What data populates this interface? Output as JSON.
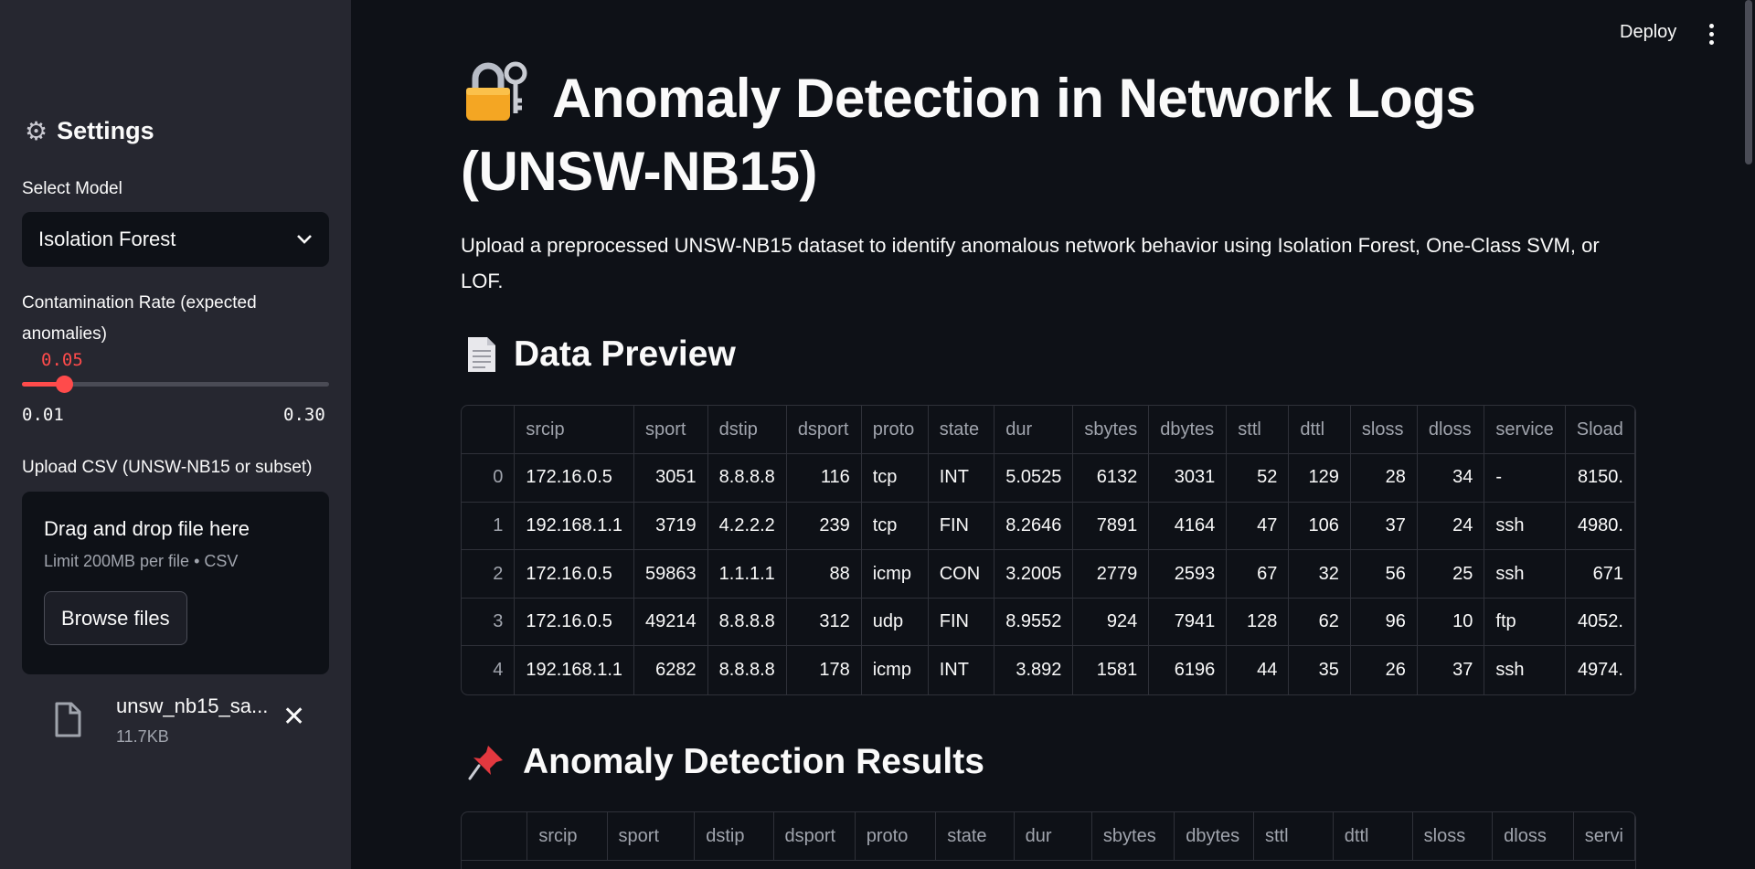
{
  "app": {
    "deploy_label": "Deploy",
    "title": "Anomaly Detection in Network Logs (UNSW-NB15)",
    "description": "Upload a preprocessed UNSW-NB15 dataset to identify anomalous network behavior using Isolation Forest, One-Class SVM, or LOF."
  },
  "sidebar": {
    "title": "Settings",
    "model_label": "Select Model",
    "model_value": "Isolation Forest",
    "contamination_label": "Contamination Rate (expected anomalies)",
    "slider": {
      "value": "0.05",
      "min": "0.01",
      "max": "0.30",
      "fraction": 0.1379
    },
    "upload_label": "Upload CSV (UNSW-NB15 or subset)",
    "dropzone_title": "Drag and drop file here",
    "dropzone_limit": "Limit 200MB per file • CSV",
    "browse_label": "Browse files",
    "file_name": "unsw_nb15_sa...",
    "file_size": "11.7KB"
  },
  "sections": {
    "preview_title": "Data Preview",
    "results_title": "Anomaly Detection Results"
  },
  "preview_table": {
    "columns": [
      "",
      "srcip",
      "sport",
      "dstip",
      "dsport",
      "proto",
      "state",
      "dur",
      "sbytes",
      "dbytes",
      "sttl",
      "dttl",
      "sloss",
      "dloss",
      "service",
      "Sload"
    ],
    "rows": [
      [
        "0",
        "172.16.0.5",
        "3051",
        "8.8.8.8",
        "116",
        "tcp",
        "INT",
        "5.0525",
        "6132",
        "3031",
        "52",
        "129",
        "28",
        "34",
        "-",
        "8150."
      ],
      [
        "1",
        "192.168.1.1",
        "3719",
        "4.2.2.2",
        "239",
        "tcp",
        "FIN",
        "8.2646",
        "7891",
        "4164",
        "47",
        "106",
        "37",
        "24",
        "ssh",
        "4980."
      ],
      [
        "2",
        "172.16.0.5",
        "59863",
        "1.1.1.1",
        "88",
        "icmp",
        "CON",
        "3.2005",
        "2779",
        "2593",
        "67",
        "32",
        "56",
        "25",
        "ssh",
        "671"
      ],
      [
        "3",
        "172.16.0.5",
        "49214",
        "8.8.8.8",
        "312",
        "udp",
        "FIN",
        "8.9552",
        "924",
        "7941",
        "128",
        "62",
        "96",
        "10",
        "ftp",
        "4052."
      ],
      [
        "4",
        "192.168.1.1",
        "6282",
        "8.8.8.8",
        "178",
        "icmp",
        "INT",
        "3.892",
        "1581",
        "6196",
        "44",
        "35",
        "26",
        "37",
        "ssh",
        "4974."
      ]
    ]
  },
  "results_table": {
    "columns": [
      "",
      "srcip",
      "sport",
      "dstip",
      "dsport",
      "proto",
      "state",
      "dur",
      "sbytes",
      "dbytes",
      "sttl",
      "dttl",
      "sloss",
      "dloss",
      "servi"
    ]
  }
}
